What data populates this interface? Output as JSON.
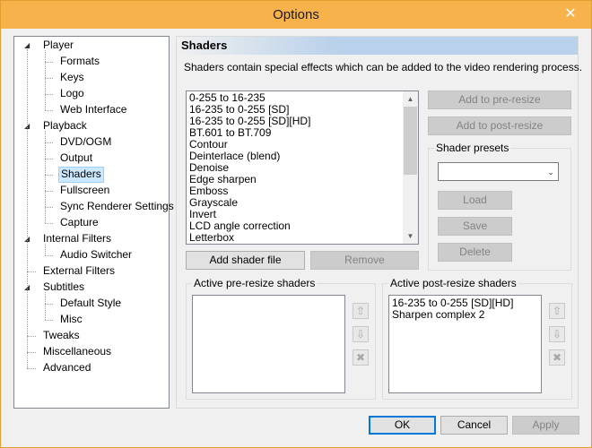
{
  "window": {
    "title": "Options",
    "close_glyph": "✕"
  },
  "tree": {
    "items": [
      {
        "label": "Player",
        "level": 0,
        "expanded": true
      },
      {
        "label": "Formats",
        "level": 1
      },
      {
        "label": "Keys",
        "level": 1
      },
      {
        "label": "Logo",
        "level": 1
      },
      {
        "label": "Web Interface",
        "level": 1
      },
      {
        "label": "Playback",
        "level": 0,
        "expanded": true
      },
      {
        "label": "DVD/OGM",
        "level": 1
      },
      {
        "label": "Output",
        "level": 1
      },
      {
        "label": "Shaders",
        "level": 1,
        "selected": true
      },
      {
        "label": "Fullscreen",
        "level": 1
      },
      {
        "label": "Sync Renderer Settings",
        "level": 1
      },
      {
        "label": "Capture",
        "level": 1
      },
      {
        "label": "Internal Filters",
        "level": 0,
        "expanded": true
      },
      {
        "label": "Audio Switcher",
        "level": 1
      },
      {
        "label": "External Filters",
        "level": 0
      },
      {
        "label": "Subtitles",
        "level": 0,
        "expanded": true
      },
      {
        "label": "Default Style",
        "level": 1
      },
      {
        "label": "Misc",
        "level": 1
      },
      {
        "label": "Tweaks",
        "level": 0
      },
      {
        "label": "Miscellaneous",
        "level": 0
      },
      {
        "label": "Advanced",
        "level": 0
      }
    ]
  },
  "page": {
    "title": "Shaders",
    "description": "Shaders contain special effects which can be added to the video rendering process.",
    "shader_list": [
      "0-255 to 16-235",
      "16-235 to 0-255 [SD]",
      "16-235 to 0-255 [SD][HD]",
      "BT.601 to BT.709",
      "Contour",
      "Deinterlace (blend)",
      "Denoise",
      "Edge sharpen",
      "Emboss",
      "Grayscale",
      "Invert",
      "LCD angle correction",
      "Letterbox"
    ],
    "add_pre_resize": "Add to pre-resize",
    "add_post_resize": "Add to post-resize",
    "presets": {
      "title": "Shader presets",
      "selected": "",
      "load": "Load",
      "save": "Save",
      "delete": "Delete"
    },
    "add_shader_file": "Add shader file",
    "remove": "Remove",
    "pre_resize": {
      "title": "Active pre-resize shaders",
      "items": []
    },
    "post_resize": {
      "title": "Active post-resize shaders",
      "items": [
        "16-235 to 0-255 [SD][HD]",
        "Sharpen complex 2"
      ]
    }
  },
  "footer": {
    "ok": "OK",
    "cancel": "Cancel",
    "apply": "Apply"
  }
}
